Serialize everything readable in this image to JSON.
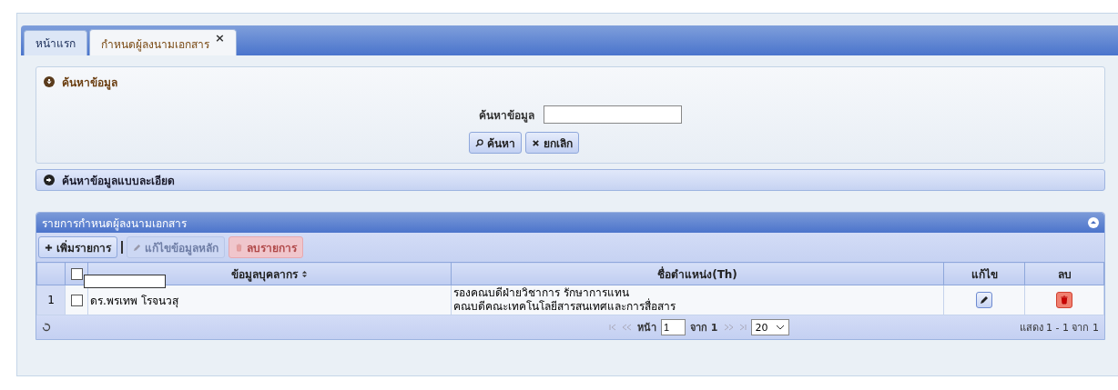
{
  "tabs": [
    {
      "label": "หน้าแรก",
      "selected": false,
      "closable": false
    },
    {
      "label": "กำหนดผู้ลงนามเอกสาร",
      "selected": true,
      "closable": true,
      "close": "×"
    }
  ],
  "search_panel": {
    "title": "ค้นหาข้อมูล",
    "expanded": true,
    "field_label": "ค้นหาข้อมูล",
    "buttons": [
      {
        "label": "ค้นหา",
        "kind": "search"
      },
      {
        "label": "ยกเลิก",
        "kind": "cancel"
      }
    ]
  },
  "advanced_panel": {
    "title": "ค้นหาข้อมูลแบบละเอียด",
    "expanded": false
  },
  "grid": {
    "title": "รายการกำหนดผู้ลงนามเอกสาร",
    "toolbar": [
      {
        "label": "เพิ่มรายการ",
        "kind": "add",
        "disabled": false
      },
      {
        "label": "แก้ไขข้อมูลหลัก",
        "kind": "edit",
        "disabled": true
      },
      {
        "label": "ลบรายการ",
        "kind": "delete",
        "disabled": true
      }
    ],
    "select_all": {
      "checked": false
    },
    "columns": [
      {
        "label": "ข้อมูลบุคลากร",
        "sortable": true
      },
      {
        "label": "ชื่อตำแหน่ง(Th)",
        "sortable": false
      },
      {
        "label": "แก้ไข",
        "sortable": false
      },
      {
        "label": "ลบ",
        "sortable": false
      }
    ],
    "rows": [
      {
        "number": "1",
        "checked": false,
        "person": "ดร.พรเทพ โรจนวสุ",
        "position": [
          "รองคณบดีฝ่ายวิชาการ รักษาการแทน",
          "คณบดีคณะเทคโนโลยีสารสนเทศและการสื่อสาร"
        ]
      }
    ],
    "pager": {
      "page_label": "หน้า",
      "page": "1",
      "of": "จาก 1",
      "page_size": "20",
      "summary": "แสดง 1 - 1 จาก 1"
    }
  }
}
